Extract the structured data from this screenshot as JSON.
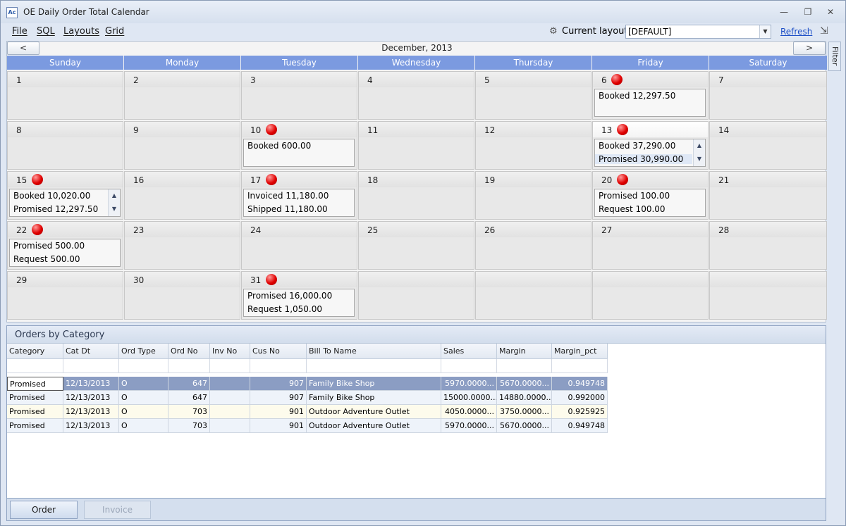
{
  "window": {
    "title": "OE Daily Order Total Calendar",
    "icon_text": "Ac"
  },
  "menu": {
    "items": [
      "File",
      "SQL",
      "Layouts",
      "Grid"
    ]
  },
  "layout": {
    "label": "Current layout",
    "value": "[DEFAULT]",
    "refresh": "Refresh"
  },
  "filter_tab": "Filter",
  "calendar": {
    "month": "December, 2013",
    "prev": "<",
    "next": ">",
    "days_of_week": [
      "Sunday",
      "Monday",
      "Tuesday",
      "Wednesday",
      "Thursday",
      "Friday",
      "Saturday"
    ],
    "weeks": [
      [
        {
          "n": "1"
        },
        {
          "n": "2"
        },
        {
          "n": "3"
        },
        {
          "n": "4"
        },
        {
          "n": "5"
        },
        {
          "n": "6",
          "dot": true,
          "lines": [
            "Booked 12,297.50"
          ]
        },
        {
          "n": "7"
        }
      ],
      [
        {
          "n": "8"
        },
        {
          "n": "9"
        },
        {
          "n": "10",
          "dot": true,
          "lines": [
            "Booked 600.00"
          ]
        },
        {
          "n": "11"
        },
        {
          "n": "12"
        },
        {
          "n": "13",
          "dot": true,
          "lines": [
            "Booked 37,290.00",
            "Promised 30,990.00"
          ],
          "scroll": true,
          "selected_line": 1,
          "today": true
        },
        {
          "n": "14"
        }
      ],
      [
        {
          "n": "15",
          "dot": true,
          "lines": [
            "Booked 10,020.00",
            "Promised 12,297.50"
          ],
          "scroll": true
        },
        {
          "n": "16"
        },
        {
          "n": "17",
          "dot": true,
          "lines": [
            "Invoiced 11,180.00",
            "Shipped 11,180.00"
          ]
        },
        {
          "n": "18"
        },
        {
          "n": "19"
        },
        {
          "n": "20",
          "dot": true,
          "lines": [
            "Promised 100.00",
            "Request 100.00"
          ]
        },
        {
          "n": "21"
        }
      ],
      [
        {
          "n": "22",
          "dot": true,
          "lines": [
            "Promised 500.00",
            "Request 500.00"
          ]
        },
        {
          "n": "23"
        },
        {
          "n": "24"
        },
        {
          "n": "25"
        },
        {
          "n": "26"
        },
        {
          "n": "27"
        },
        {
          "n": "28"
        }
      ],
      [
        {
          "n": "29"
        },
        {
          "n": "30"
        },
        {
          "n": "31",
          "dot": true,
          "lines": [
            "Promised 16,000.00",
            "Request 1,050.00"
          ]
        },
        {
          "n": ""
        },
        {
          "n": ""
        },
        {
          "n": ""
        },
        {
          "n": ""
        }
      ]
    ]
  },
  "orders": {
    "title": "Orders by Category",
    "columns": [
      "Category",
      "Cat Dt",
      "Ord Type",
      "Ord No",
      "Inv No",
      "Cus No",
      "Bill To Name",
      "Sales",
      "Margin",
      "Margin_pct"
    ],
    "rows": [
      [
        "Promised",
        "12/13/2013",
        "O",
        "647",
        "",
        "907",
        "Family Bike Shop",
        "5970.0000...",
        "5670.0000...",
        "0.949748"
      ],
      [
        "Promised",
        "12/13/2013",
        "O",
        "647",
        "",
        "907",
        "Family Bike Shop",
        "15000.0000...",
        "14880.0000...",
        "0.992000"
      ],
      [
        "Promised",
        "12/13/2013",
        "O",
        "703",
        "",
        "901",
        "Outdoor Adventure Outlet",
        "4050.0000...",
        "3750.0000...",
        "0.925925"
      ],
      [
        "Promised",
        "12/13/2013",
        "O",
        "703",
        "",
        "901",
        "Outdoor Adventure Outlet",
        "5970.0000...",
        "5670.0000...",
        "0.949748"
      ]
    ]
  },
  "bottom_tabs": [
    "Order",
    "Invoice"
  ]
}
